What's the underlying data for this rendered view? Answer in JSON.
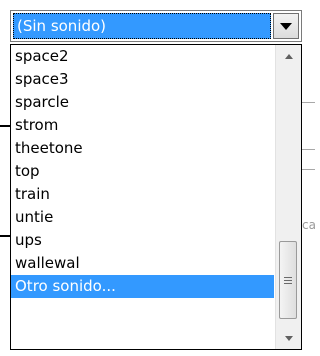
{
  "combo": {
    "selected_value": "(Sin sonido)"
  },
  "list": {
    "items": [
      {
        "label": "space2"
      },
      {
        "label": "space3"
      },
      {
        "label": "sparcle"
      },
      {
        "label": "strom"
      },
      {
        "label": "theetone"
      },
      {
        "label": "top"
      },
      {
        "label": "train"
      },
      {
        "label": "untie"
      },
      {
        "label": "ups"
      },
      {
        "label": "wallewal"
      },
      {
        "label": "Otro sonido...",
        "selected": true
      }
    ]
  },
  "background": {
    "partial_text": "ca"
  },
  "colors": {
    "highlight": "#3399ff",
    "highlight_text": "#ffffff"
  },
  "icons": {
    "combo_button": "chevron-down-icon",
    "scroll_up": "scroll-up-arrow-icon",
    "scroll_down": "scroll-down-arrow-icon",
    "scroll_grip": "grip-icon"
  }
}
